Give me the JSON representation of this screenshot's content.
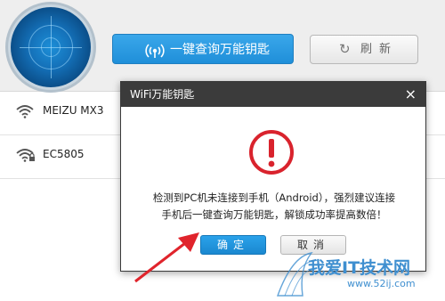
{
  "toolbar": {
    "query_button_label": "一键查询万能钥匙",
    "refresh_button_label": "刷新",
    "refresh_icon_glyph": "↻"
  },
  "networks": [
    {
      "name": "MEIZU MX3"
    },
    {
      "name": "EC5805"
    }
  ],
  "dialog": {
    "title": "WiFi万能钥匙",
    "close_glyph": "×",
    "message_line1": "检测到PC机未连接到手机（Android），强烈建议连接",
    "message_line2": "手机后一键查询万能钥匙，解锁成功率提高数倍！",
    "ok_label": "确定",
    "cancel_label": "取消"
  },
  "watermark": {
    "text": "我爱IT技术网",
    "sub": "www.52ij.com"
  },
  "colors": {
    "accent_blue": "#1f8fd9",
    "warning_red": "#d9232d",
    "annotation_red": "#e0242c"
  },
  "icons": {
    "query": "wifi-signal-icon",
    "refresh": "refresh-icon",
    "network": "wifi-icon",
    "warning": "warning-icon",
    "close": "close-icon"
  }
}
